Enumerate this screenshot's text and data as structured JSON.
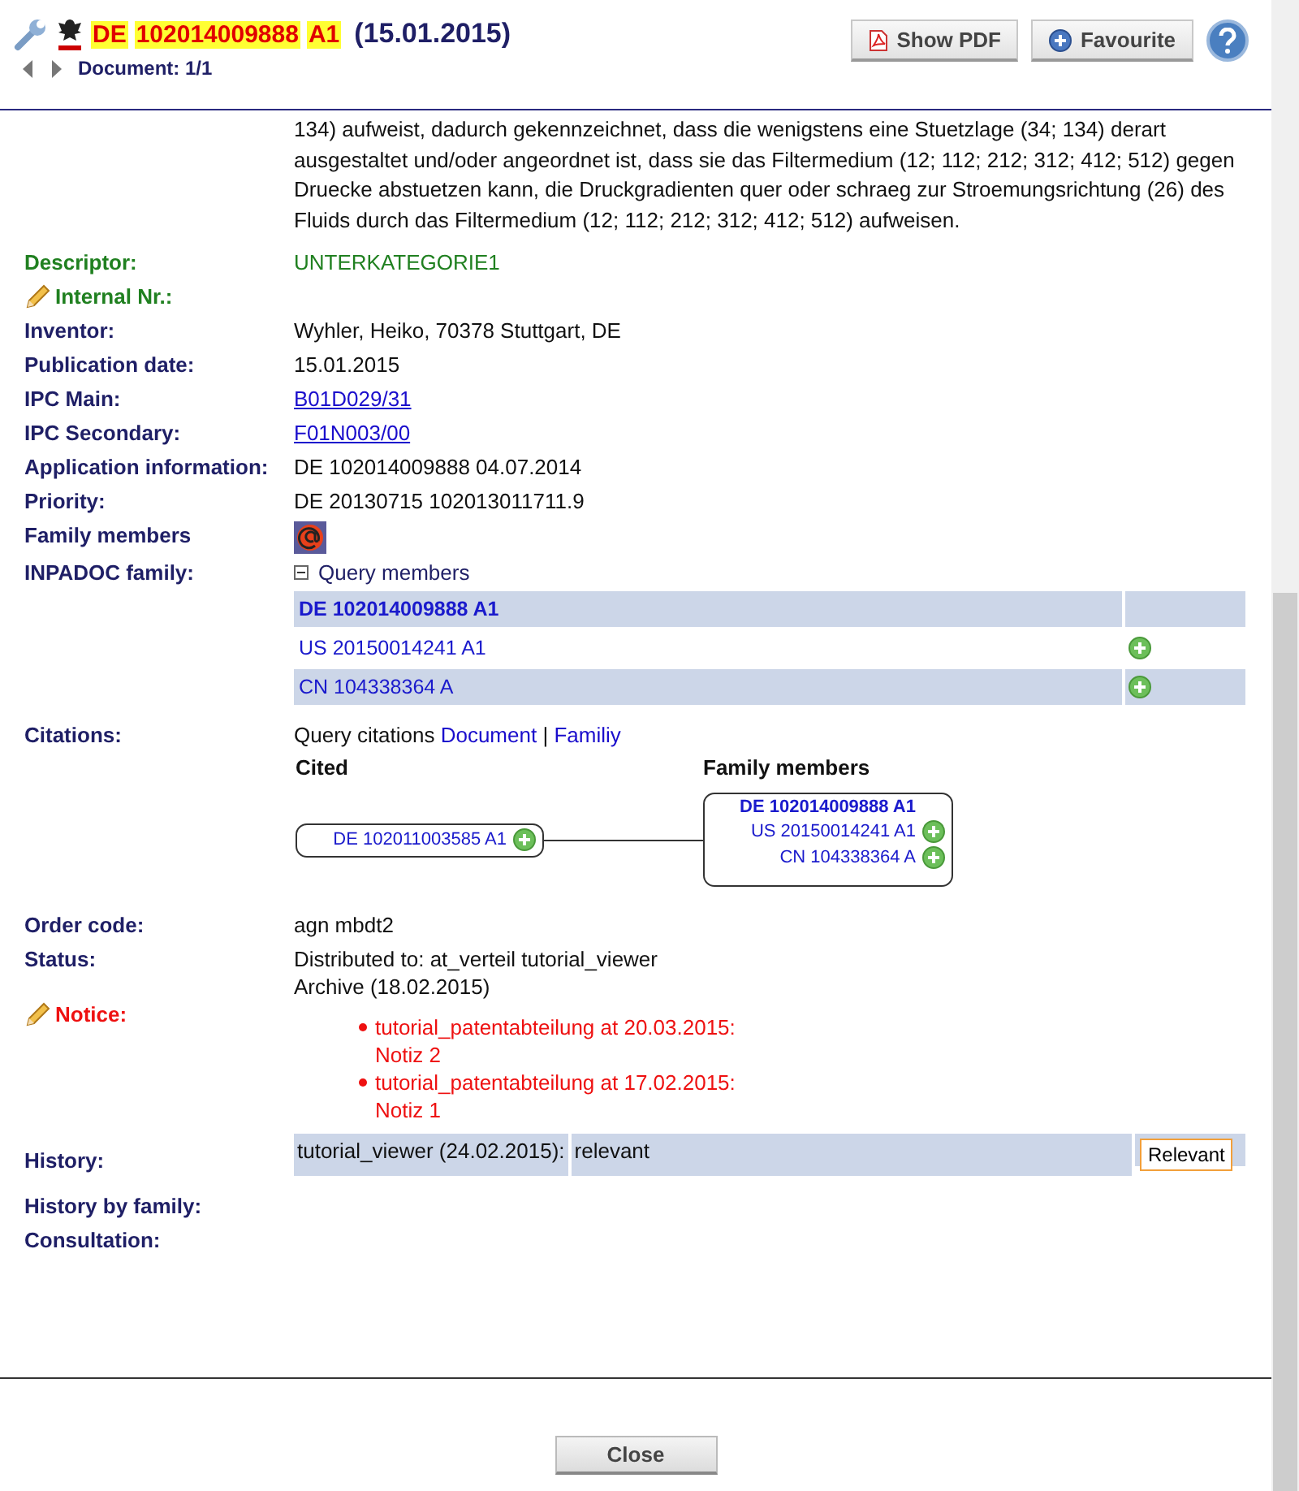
{
  "header": {
    "title_parts": [
      "DE",
      "102014009888",
      "A1"
    ],
    "date": "(15.01.2015)",
    "document_nav": "Document: 1/1",
    "buttons": [
      {
        "kind": "pdf",
        "label": "Show PDF"
      },
      {
        "kind": "favourite",
        "label": "Favourite"
      }
    ]
  },
  "abstract_text": "134) aufweist, dadurch gekennzeichnet, dass die wenigstens eine Stuetzlage (34; 134) derart ausgestaltet und/oder angeordnet ist, dass sie das Filtermedium (12; 112; 212; 312; 412; 512) gegen Druecke abstuetzen kann, die Druckgradienten quer oder schraeg zur Stroemungsrichtung (26) des Fluids durch das Filtermedium (12; 112; 212; 312; 412; 512) aufweisen.",
  "fields": [
    {
      "kind": "descriptor",
      "label": "Descriptor:",
      "color": "#208020",
      "value": "UNTERKATEGORIE1"
    },
    {
      "kind": "empty",
      "label": "Internal Nr.:",
      "color": "#208020",
      "editable": true
    },
    {
      "kind": "text",
      "label": "Inventor:",
      "color": "#1f1f66",
      "value": "Wyhler, Heiko, 70378 Stuttgart, DE"
    },
    {
      "kind": "text",
      "label": "Publication date:",
      "color": "#1f1f66",
      "value": "15.01.2015"
    },
    {
      "kind": "link",
      "label": "IPC Main:",
      "color": "#1f1f66",
      "value": "B01D029/31"
    },
    {
      "kind": "link",
      "label": "IPC Secondary:",
      "color": "#1f1f66",
      "value": "F01N003/00"
    },
    {
      "kind": "text",
      "label": "Application information:",
      "color": "#1f1f66",
      "value": "DE 102014009888 04.07.2014"
    },
    {
      "kind": "text",
      "label": "Priority:",
      "color": "#1f1f66",
      "value": "DE 20130715 102013011711.9"
    },
    {
      "kind": "icon",
      "label": "Family members",
      "color": "#1f1f66"
    },
    {
      "kind": "inpadoc",
      "label": "INPADOC family:",
      "color": "#1f1f66",
      "toggle": "Query members",
      "expanded": true,
      "members": [
        {
          "number": "DE 102014009888 A1",
          "current": true
        },
        {
          "number": "US 20150014241 A1",
          "current": false
        },
        {
          "number": "CN 104338364 A",
          "current": false
        }
      ]
    },
    {
      "kind": "citations",
      "label": "Citations:",
      "color": "#1f1f66",
      "query": "Query citations",
      "links": [
        "Document",
        "Familiy"
      ],
      "separator": "|",
      "cited_heading": "Cited",
      "cited": [
        "DE 102011003585 A1"
      ],
      "family_heading": "Family members",
      "family": [
        {
          "number": "DE 102014009888 A1",
          "current": true
        },
        {
          "number": "US 20150014241 A1",
          "current": false
        },
        {
          "number": "CN 104338364 A",
          "current": false
        }
      ]
    },
    {
      "kind": "text",
      "label": "Order code:",
      "color": "#1f1f66",
      "value": "agn mbdt2"
    },
    {
      "kind": "lines",
      "label": "Status:",
      "color": "#1f1f66",
      "lines": [
        "Distributed to: at_verteil tutorial_viewer",
        "Archive (18.02.2015)"
      ]
    },
    {
      "kind": "notice",
      "label": "Notice:",
      "color": "#ee1111",
      "editable": true,
      "notes": [
        {
          "head": "tutorial_patentabteilung at 20.03.2015:",
          "body": "Notiz 2"
        },
        {
          "head": "tutorial_patentabteilung at 17.02.2015:",
          "body": "Notiz 1"
        }
      ]
    },
    {
      "kind": "history",
      "label": "History:",
      "color": "#1f1f66",
      "user": "tutorial_viewer (24.02.2015):",
      "rating": "relevant",
      "button": "Relevant"
    },
    {
      "kind": "empty",
      "label": "History by family:",
      "color": "#1f1f66"
    },
    {
      "kind": "empty",
      "label": "Consultation:",
      "color": "#1f1f66"
    }
  ],
  "footer": {
    "close": "Close"
  }
}
